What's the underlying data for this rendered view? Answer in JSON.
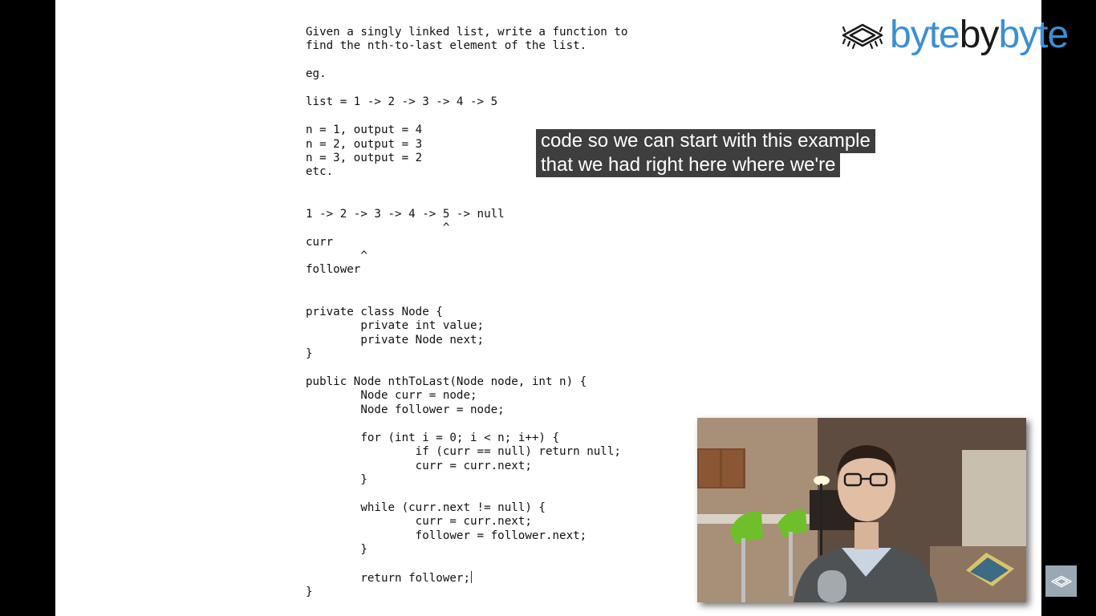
{
  "slide": {
    "code_lines": [
      "Given a singly linked list, write a function to",
      "find the nth-to-last element of the list.",
      "",
      "eg.",
      "",
      "list = 1 -> 2 -> 3 -> 4 -> 5",
      "",
      "n = 1, output = 4",
      "n = 2, output = 3",
      "n = 3, output = 2",
      "etc.",
      "",
      "",
      "1 -> 2 -> 3 -> 4 -> 5 -> null",
      "                    ^",
      "curr",
      "        ^",
      "follower",
      "",
      "",
      "private class Node {",
      "        private int value;",
      "        private Node next;",
      "}",
      "",
      "public Node nthToLast(Node node, int n) {",
      "        Node curr = node;",
      "        Node follower = node;",
      "",
      "        for (int i = 0; i < n; i++) {",
      "                if (curr == null) return null;",
      "                curr = curr.next;",
      "        }",
      "",
      "        while (curr.next != null) {",
      "                curr = curr.next;",
      "                follower = follower.next;",
      "        }",
      "",
      "        return follower;",
      "}"
    ]
  },
  "logo": {
    "part_a": "byte",
    "part_b": "by",
    "part_c": "byte",
    "primary_color": "#3a8fd6",
    "secondary_color": "#1a1a1a",
    "icon": "chip-icon"
  },
  "captions": {
    "line1": "code so we can start with this example",
    "line2": "that we had right here where we're"
  },
  "webcam": {
    "icon": "presenter-video"
  },
  "corner_watermark": {
    "icon": "channel-watermark-icon"
  }
}
